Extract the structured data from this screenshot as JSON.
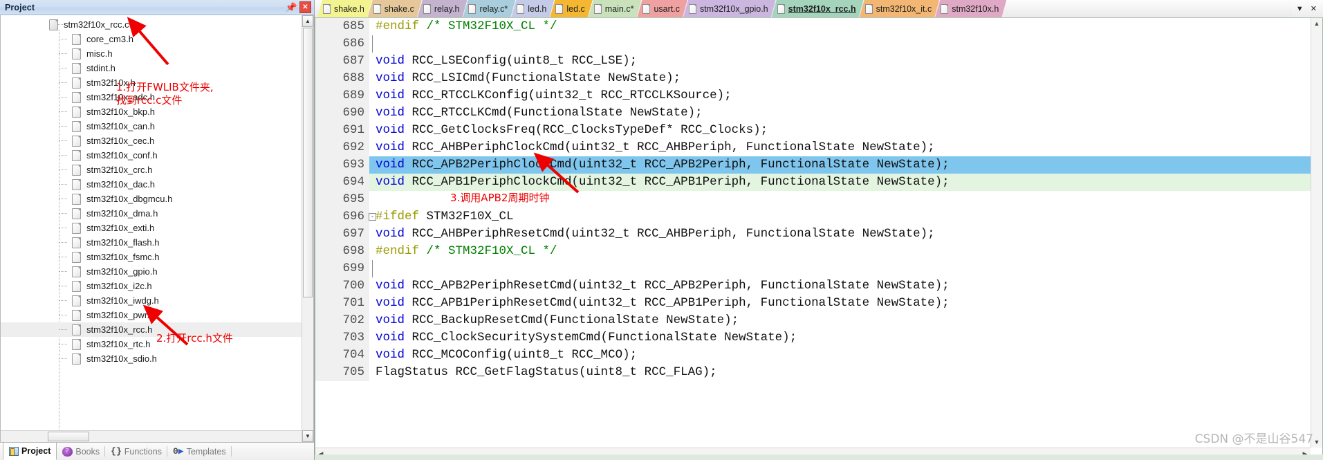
{
  "project_pane": {
    "title": "Project",
    "pin_icon": "pin-icon",
    "close_icon": "close-icon",
    "tree": {
      "root": {
        "label": "stm32f10x_rcc.c",
        "expander": "-"
      },
      "children": [
        {
          "label": "core_cm3.h"
        },
        {
          "label": "misc.h"
        },
        {
          "label": "stdint.h"
        },
        {
          "label": "stm32f10x.h"
        },
        {
          "label": "stm32f10x_adc.h"
        },
        {
          "label": "stm32f10x_bkp.h"
        },
        {
          "label": "stm32f10x_can.h"
        },
        {
          "label": "stm32f10x_cec.h"
        },
        {
          "label": "stm32f10x_conf.h"
        },
        {
          "label": "stm32f10x_crc.h"
        },
        {
          "label": "stm32f10x_dac.h"
        },
        {
          "label": "stm32f10x_dbgmcu.h"
        },
        {
          "label": "stm32f10x_dma.h"
        },
        {
          "label": "stm32f10x_exti.h"
        },
        {
          "label": "stm32f10x_flash.h"
        },
        {
          "label": "stm32f10x_fsmc.h"
        },
        {
          "label": "stm32f10x_gpio.h"
        },
        {
          "label": "stm32f10x_i2c.h"
        },
        {
          "label": "stm32f10x_iwdg.h"
        },
        {
          "label": "stm32f10x_pwr.h"
        },
        {
          "label": "stm32f10x_rcc.h",
          "selected": true
        },
        {
          "label": "stm32f10x_rtc.h"
        },
        {
          "label": "stm32f10x_sdio.h"
        }
      ]
    },
    "bottom_tabs": [
      {
        "label": "Project",
        "icon": "project-icon",
        "active": true
      },
      {
        "label": "Books",
        "icon": "books-icon",
        "active": false
      },
      {
        "label": "Functions",
        "icon": "functions-icon",
        "active": false
      },
      {
        "label": "Templates",
        "icon": "templates-icon",
        "active": false
      }
    ]
  },
  "annotations": [
    {
      "id": "ann1",
      "text_line1": "1.打开FWLIB文件夹,",
      "text_line2": "找到rcc.c文件"
    },
    {
      "id": "ann2",
      "text_line1": "2.打开rcc.h文件"
    },
    {
      "id": "ann3",
      "text_line1": "3.调用APB2周期时钟"
    }
  ],
  "editor": {
    "tabs": [
      {
        "label": "shake.h",
        "color": "#f3f38f",
        "active": false
      },
      {
        "label": "shake.c",
        "color": "#e6c79a",
        "active": false
      },
      {
        "label": "relay.h",
        "color": "#c3b3cf",
        "active": false
      },
      {
        "label": "relay.c*",
        "color": "#a9cddc",
        "active": false
      },
      {
        "label": "led.h",
        "color": "#c3cbe8",
        "active": false
      },
      {
        "label": "led.c",
        "color": "#f5b731",
        "active": false
      },
      {
        "label": "main.c*",
        "color": "#c9e2bb",
        "active": false
      },
      {
        "label": "usart.c",
        "color": "#efa0a0",
        "active": false
      },
      {
        "label": "stm32f10x_gpio.h",
        "color": "#cbb6e0",
        "active": false
      },
      {
        "label": "stm32f10x_rcc.h",
        "color": "#a5d4bd",
        "active": true
      },
      {
        "label": "stm32f10x_it.c",
        "color": "#f3b773",
        "active": false
      },
      {
        "label": "stm32f10x.h",
        "color": "#dfa9c5",
        "active": false
      }
    ],
    "overflow_icon": "chevron-down-icon",
    "close_icon": "close-icon",
    "first_line_number": 685,
    "lines": [
      {
        "n": "685",
        "fold": "",
        "tokens": [
          {
            "t": "#endif ",
            "c": "pre"
          },
          {
            "t": "/* STM32F10X_CL */",
            "c": "cmt"
          }
        ]
      },
      {
        "n": "686",
        "fold": "|",
        "tokens": []
      },
      {
        "n": "687",
        "fold": "",
        "tokens": [
          {
            "t": "void",
            "c": "kw"
          },
          {
            "t": " RCC_LSEConfig(uint8_t RCC_LSE);",
            "c": "plain"
          }
        ]
      },
      {
        "n": "688",
        "fold": "",
        "tokens": [
          {
            "t": "void",
            "c": "kw"
          },
          {
            "t": " RCC_LSICmd(FunctionalState NewState);",
            "c": "plain"
          }
        ]
      },
      {
        "n": "689",
        "fold": "",
        "tokens": [
          {
            "t": "void",
            "c": "kw"
          },
          {
            "t": " RCC_RTCCLKConfig(uint32_t RCC_RTCCLKSource);",
            "c": "plain"
          }
        ]
      },
      {
        "n": "690",
        "fold": "",
        "tokens": [
          {
            "t": "void",
            "c": "kw"
          },
          {
            "t": " RCC_RTCCLKCmd(FunctionalState NewState);",
            "c": "plain"
          }
        ]
      },
      {
        "n": "691",
        "fold": "",
        "tokens": [
          {
            "t": "void",
            "c": "kw"
          },
          {
            "t": " RCC_GetClocksFreq(RCC_ClocksTypeDef* RCC_Clocks);",
            "c": "plain"
          }
        ]
      },
      {
        "n": "692",
        "fold": "",
        "tokens": [
          {
            "t": "void",
            "c": "kw"
          },
          {
            "t": " RCC_AHBPeriphClockCmd(uint32_t RCC_AHBPeriph, FunctionalState NewState);",
            "c": "plain"
          }
        ]
      },
      {
        "n": "693",
        "fold": "",
        "hl": "sel",
        "tokens": [
          {
            "t": "void",
            "c": "kw"
          },
          {
            "t": " RCC_APB2PeriphClockCmd(uint32_t RCC_APB2Periph, FunctionalState NewState);",
            "c": "plain"
          }
        ]
      },
      {
        "n": "694",
        "fold": "",
        "hl": "green",
        "tokens": [
          {
            "t": "void",
            "c": "kw"
          },
          {
            "t": " RCC_APB1PeriphClockCmd(uint32_t RCC_APB1Periph, FunctionalState NewState);",
            "c": "plain"
          }
        ]
      },
      {
        "n": "695",
        "fold": "",
        "tokens": []
      },
      {
        "n": "696",
        "fold": "-",
        "tokens": [
          {
            "t": "#ifdef",
            "c": "pre"
          },
          {
            "t": " STM32F10X_CL",
            "c": "plain"
          }
        ]
      },
      {
        "n": "697",
        "fold": "",
        "tokens": [
          {
            "t": "void",
            "c": "kw"
          },
          {
            "t": " RCC_AHBPeriphResetCmd(uint32_t RCC_AHBPeriph, FunctionalState NewState);",
            "c": "plain"
          }
        ]
      },
      {
        "n": "698",
        "fold": "",
        "tokens": [
          {
            "t": "#endif ",
            "c": "pre"
          },
          {
            "t": "/* STM32F10X_CL */",
            "c": "cmt"
          }
        ]
      },
      {
        "n": "699",
        "fold": "|",
        "tokens": []
      },
      {
        "n": "700",
        "fold": "",
        "tokens": [
          {
            "t": "void",
            "c": "kw"
          },
          {
            "t": " RCC_APB2PeriphResetCmd(uint32_t RCC_APB2Periph, FunctionalState NewState);",
            "c": "plain"
          }
        ]
      },
      {
        "n": "701",
        "fold": "",
        "tokens": [
          {
            "t": "void",
            "c": "kw"
          },
          {
            "t": " RCC_APB1PeriphResetCmd(uint32_t RCC_APB1Periph, FunctionalState NewState);",
            "c": "plain"
          }
        ]
      },
      {
        "n": "702",
        "fold": "",
        "tokens": [
          {
            "t": "void",
            "c": "kw"
          },
          {
            "t": " RCC_BackupResetCmd(FunctionalState NewState);",
            "c": "plain"
          }
        ]
      },
      {
        "n": "703",
        "fold": "",
        "tokens": [
          {
            "t": "void",
            "c": "kw"
          },
          {
            "t": " RCC_ClockSecuritySystemCmd(FunctionalState NewState);",
            "c": "plain"
          }
        ]
      },
      {
        "n": "704",
        "fold": "",
        "tokens": [
          {
            "t": "void",
            "c": "kw"
          },
          {
            "t": " RCC_MCOConfig(uint8_t RCC_MCO);",
            "c": "plain"
          }
        ]
      },
      {
        "n": "705",
        "fold": "",
        "tokens": [
          {
            "t": "FlagStatus RCC_GetFlagStatus(uint8_t RCC_FLAG);",
            "c": "plain"
          }
        ]
      }
    ]
  },
  "watermark": "CSDN @不是山谷547",
  "colors": {
    "selection_blue": "#7fc6ee",
    "modified_green": "#e3f4e0",
    "keyword_blue": "#0000d0",
    "comment_green": "#008000",
    "preproc_olive": "#9a9a00",
    "annotation_red": "#ee0000",
    "active_tab_green": "#a5d4bd"
  }
}
